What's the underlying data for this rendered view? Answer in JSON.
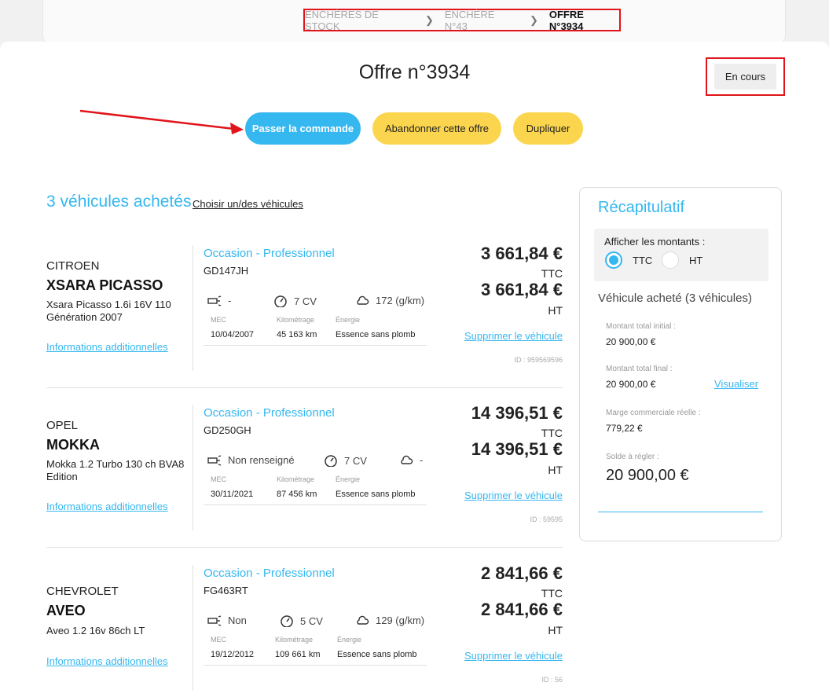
{
  "breadcrumb": [
    "ENCHÈRES DE STOCK",
    "ENCHÈRE N°43",
    "OFFRE N°3934"
  ],
  "title": "Offre n°3934",
  "status": "En cours",
  "actions": {
    "order": "Passer la commande",
    "abandon": "Abandonner cette offre",
    "duplicate": "Dupliquer"
  },
  "vehicles_section": {
    "title": "3 véhicules achetés",
    "choose_link": "Choisir un/des véhicules"
  },
  "labels": {
    "mec": "MEC",
    "mileage": "Kilométrage",
    "energy": "Énergie",
    "delete": "Supprimer le véhicule",
    "info": "Informations additionnelles",
    "ttc": "TTC",
    "ht": "HT"
  },
  "vehicles": [
    {
      "brand": "CITROEN",
      "model": "XSARA PICASSO",
      "version": "Xsara Picasso 1.6i 16V 110 Génération 2007",
      "condition": "Occasion - Professionnel",
      "plate": "GD147JH",
      "crit_air": "-",
      "power": "7 CV",
      "co2": "172 (g/km)",
      "mec": "10/04/2007",
      "mileage": "45 163 km",
      "energy": "Essence sans plomb",
      "price_ttc": "3 661,84 €",
      "price_ht": "3 661,84 €",
      "id": "ID : 959569596"
    },
    {
      "brand": "OPEL",
      "model": "MOKKA",
      "version": "Mokka 1.2 Turbo 130 ch BVA8 Edition",
      "condition": "Occasion - Professionnel",
      "plate": "GD250GH",
      "crit_air": "Non renseigné",
      "power": "7 CV",
      "co2": "-",
      "mec": "30/11/2021",
      "mileage": "87 456 km",
      "energy": "Essence sans plomb",
      "price_ttc": "14 396,51 €",
      "price_ht": "14 396,51 €",
      "id": "ID : 59595"
    },
    {
      "brand": "CHEVROLET",
      "model": "AVEO",
      "version": "Aveo 1.2 16v 86ch LT",
      "condition": "Occasion - Professionnel",
      "plate": "FG463RT",
      "crit_air": "Non",
      "power": "5 CV",
      "co2": "129 (g/km)",
      "mec": "19/12/2012",
      "mileage": "109 661 km",
      "energy": "Essence sans plomb",
      "price_ttc": "2 841,66 €",
      "price_ht": "2 841,66 €",
      "id": "ID : 56"
    }
  ],
  "summary": {
    "title": "Récapitulatif",
    "display_label": "Afficher les montants :",
    "opt_ttc": "TTC",
    "opt_ht": "HT",
    "selected": "TTC",
    "subtitle": "Véhicule acheté (3 véhicules)",
    "initial_label": "Montant total initial :",
    "initial_value": "20 900,00 €",
    "final_label": "Montant total final :",
    "final_value": "20 900,00 €",
    "visualize": "Visualiser",
    "margin_label": "Marge commerciale réelle :",
    "margin_value": "779,22 €",
    "balance_label": "Solde à régler :",
    "balance_value": "20 900,00 €"
  },
  "colors": {
    "accent": "#35b7ef",
    "yellow": "#fbd54d",
    "annotation_red": "#e0141a"
  }
}
